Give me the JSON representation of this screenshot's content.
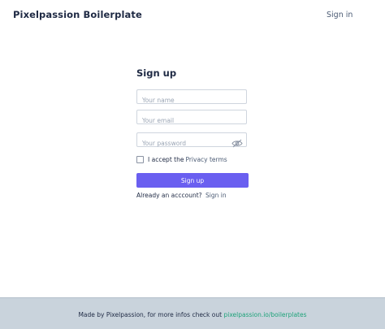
{
  "header": {
    "brand": "Pixelpassion Boilerplate",
    "signin_label": "Sign in"
  },
  "form": {
    "title": "Sign up",
    "name_placeholder": "Your name",
    "email_placeholder": "Your email",
    "password_placeholder": "Your password",
    "terms_prefix": "I accept the",
    "terms_link": "Privacy terms",
    "submit_label": "Sign up",
    "already_text": "Already an acccount?",
    "signin_link": "Sign in",
    "password_toggle_icon": "eye-slash-icon"
  },
  "footer": {
    "text": "Made by Pixelpassion, for more infos check out",
    "link": "pixelpassion.io/boilerplates"
  },
  "colors": {
    "primary": "#6a5ff0",
    "footer_bg": "#c9d3dc",
    "footer_link": "#1fa37a",
    "text_dark": "#1f2a44"
  }
}
